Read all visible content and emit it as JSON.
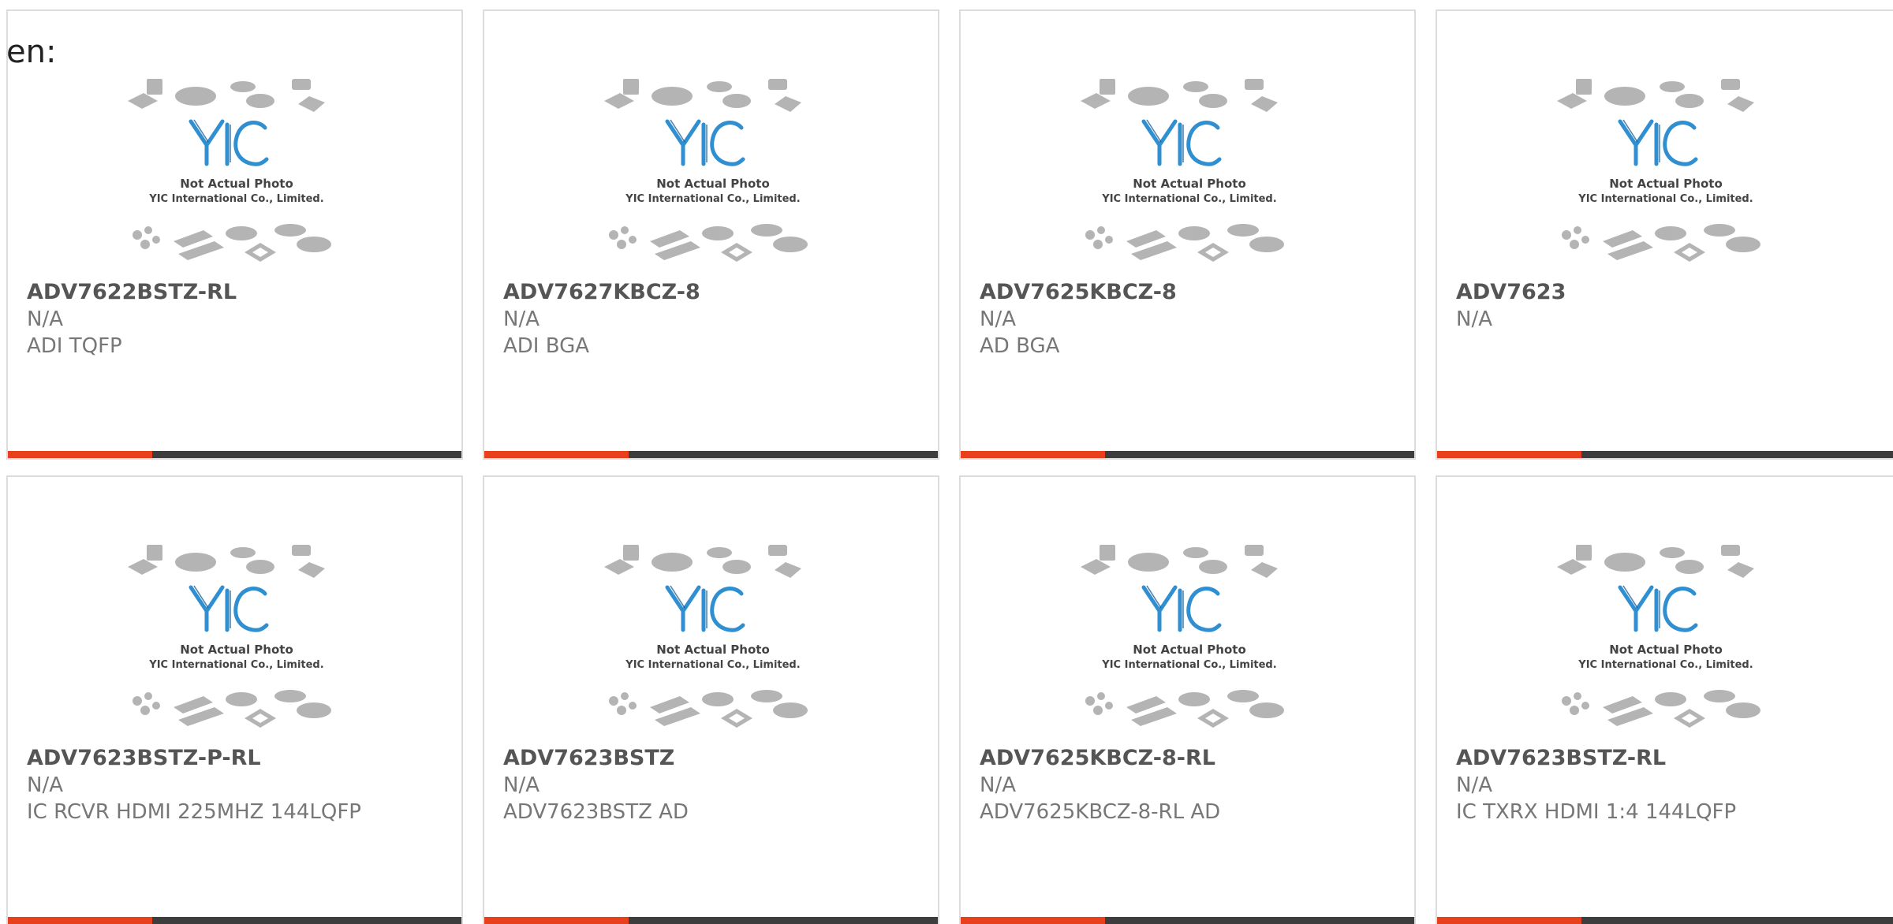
{
  "lang_label": "en:",
  "colors": {
    "accent": "#e8401c",
    "bar_dark": "#3d3d3d",
    "logo_blue": "#2f8fd0",
    "chip_gray": "#a8a8a8"
  },
  "placeholder": {
    "line1": "Not Actual Photo",
    "line2": "YIC International Co., Limited.",
    "logo_text": "YIC"
  },
  "products": [
    {
      "name": "ADV7622BSTZ-RL",
      "line1": "N/A",
      "line2": "ADI TQFP"
    },
    {
      "name": "ADV7627KBCZ-8",
      "line1": "N/A",
      "line2": "ADI BGA"
    },
    {
      "name": "ADV7625KBCZ-8",
      "line1": "N/A",
      "line2": "AD BGA"
    },
    {
      "name": "ADV7623",
      "line1": "N/A",
      "line2": ""
    },
    {
      "name": "ADV7623BSTZ-P-RL",
      "line1": "N/A",
      "line2": "IC RCVR HDMI 225MHZ 144LQFP"
    },
    {
      "name": "ADV7623BSTZ",
      "line1": "N/A",
      "line2": "ADV7623BSTZ AD"
    },
    {
      "name": "ADV7625KBCZ-8-RL",
      "line1": "N/A",
      "line2": "ADV7625KBCZ-8-RL AD"
    },
    {
      "name": "ADV7623BSTZ-RL",
      "line1": "N/A",
      "line2": "IC TXRX HDMI 1:4 144LQFP"
    }
  ]
}
